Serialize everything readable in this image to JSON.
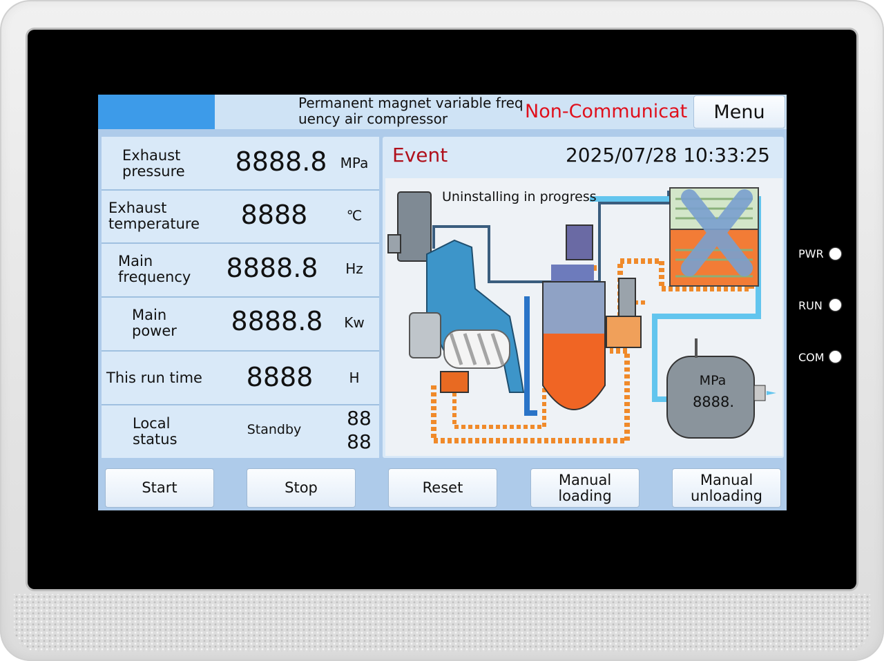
{
  "header": {
    "title": "Permanent magnet variable frequency air compressor",
    "status": "Non-Communicat",
    "menu_label": "Menu"
  },
  "readings": [
    {
      "label": "Exhaust pressure",
      "value": "8888.8",
      "unit": "MPa"
    },
    {
      "label": "Exhaust temperature",
      "value": "8888",
      "unit": "℃"
    },
    {
      "label": "Main frequency",
      "value": "8888.8",
      "unit": "Hz"
    },
    {
      "label": "Main power",
      "value": "8888.8",
      "unit": "Kw"
    },
    {
      "label": "This run time",
      "value": "8888",
      "unit": "H"
    }
  ],
  "local_status": {
    "label": "Local status",
    "value": "Standby",
    "code_top": "88",
    "code_bottom": "88"
  },
  "event": {
    "label": "Event",
    "datetime": "2025/07/28 10:33:25"
  },
  "diagram": {
    "status_text": "Uninstalling in progress",
    "tank_unit": "MPa",
    "tank_value": "8888."
  },
  "buttons": {
    "start": "Start",
    "stop": "Stop",
    "reset": "Reset",
    "manual_loading": "Manual loading",
    "manual_unloading": "Manual unloading"
  },
  "leds": {
    "pwr": "PWR",
    "run": "RUN",
    "com": "COM"
  },
  "colors": {
    "accent_blue": "#3d9be9",
    "alert_red": "#e0101c",
    "event_red": "#b0101c",
    "panel_bg": "#d9e9f8"
  }
}
